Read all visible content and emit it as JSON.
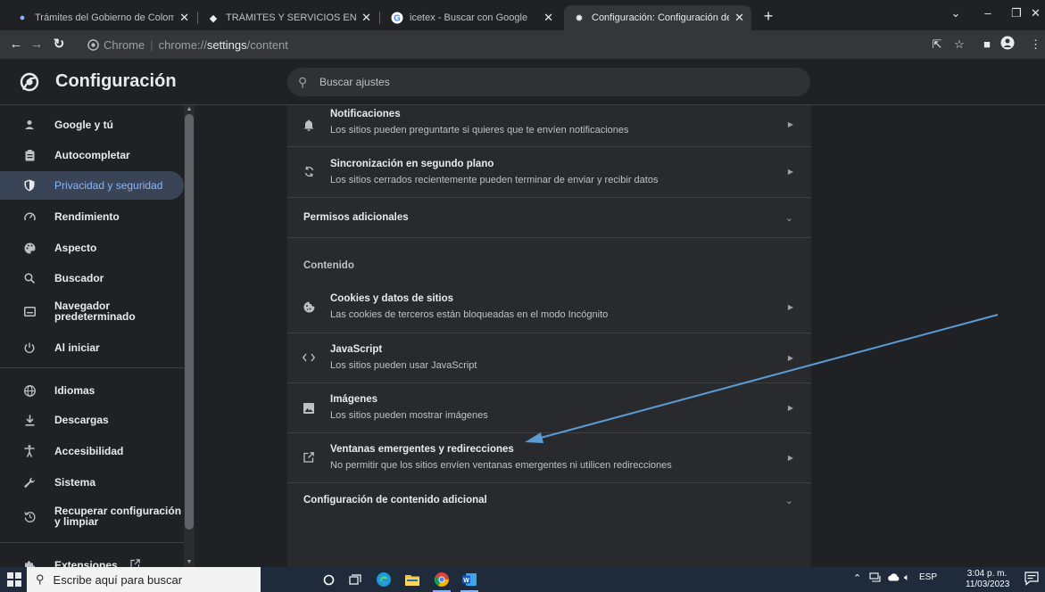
{
  "tabs": [
    {
      "title": "Trámites del Gobierno de Colombi",
      "active": false
    },
    {
      "title": "TRÁMITES Y SERVICIOS EN LINEA",
      "active": false
    },
    {
      "title": "icetex - Buscar con Google",
      "active": false
    },
    {
      "title": "Configuración: Configuración de",
      "active": true
    }
  ],
  "tab_close": "✕",
  "new_tab": "+",
  "omnibox": {
    "site_name": "Chrome",
    "url_prefix": "chrome://",
    "url_path": "settings",
    "url_suffix": "/content"
  },
  "header": {
    "title": "Configuración",
    "search_placeholder": "Buscar ajustes"
  },
  "sidebar": {
    "items": [
      {
        "label": "Google y tú",
        "icon": "person-icon"
      },
      {
        "label": "Autocompletar",
        "icon": "clipboard-icon"
      },
      {
        "label": "Privacidad y seguridad",
        "icon": "shield-icon",
        "active": true
      },
      {
        "label": "Rendimiento",
        "icon": "speedometer-icon"
      },
      {
        "label": "Aspecto",
        "icon": "palette-icon"
      },
      {
        "label": "Buscador",
        "icon": "search-icon"
      },
      {
        "label": "Navegador predeterminado",
        "icon": "browser-icon"
      },
      {
        "label": "Al iniciar",
        "icon": "power-icon"
      },
      {
        "label": "Idiomas",
        "icon": "globe-icon"
      },
      {
        "label": "Descargas",
        "icon": "download-icon"
      },
      {
        "label": "Accesibilidad",
        "icon": "accessibility-icon"
      },
      {
        "label": "Sistema",
        "icon": "wrench-icon"
      },
      {
        "label": "Recuperar configuración y limpiar",
        "icon": "restore-icon"
      },
      {
        "label": "Extensiones",
        "icon": "puzzle-icon"
      }
    ]
  },
  "content": {
    "notifications": {
      "title": "Notificaciones",
      "desc": "Los sitios pueden preguntarte si quieres que te envíen notificaciones"
    },
    "background_sync": {
      "title": "Sincronización en segundo plano",
      "desc": "Los sitios cerrados recientemente pueden terminar de enviar y recibir datos"
    },
    "additional_permissions": "Permisos adicionales",
    "content_label": "Contenido",
    "cookies": {
      "title": "Cookies y datos de sitios",
      "desc": "Las cookies de terceros están bloqueadas en el modo Incógnito"
    },
    "javascript": {
      "title": "JavaScript",
      "desc": "Los sitios pueden usar JavaScript"
    },
    "images": {
      "title": "Imágenes",
      "desc": "Los sitios pueden mostrar imágenes"
    },
    "popups": {
      "title": "Ventanas emergentes y redirecciones",
      "desc": "No permitir que los sitios envíen ventanas emergentes ni utilicen redirecciones"
    },
    "additional_content": "Configuración de contenido adicional"
  },
  "taskbar": {
    "search_placeholder": "Escribe aquí para buscar",
    "language": "ESP",
    "time": "3:04 p. m.",
    "date": "11/03/2023"
  },
  "colors": {
    "accent": "#8ab4f8",
    "active_item_bg": "#394457",
    "annotation_arrow": "#5b9bd5"
  }
}
